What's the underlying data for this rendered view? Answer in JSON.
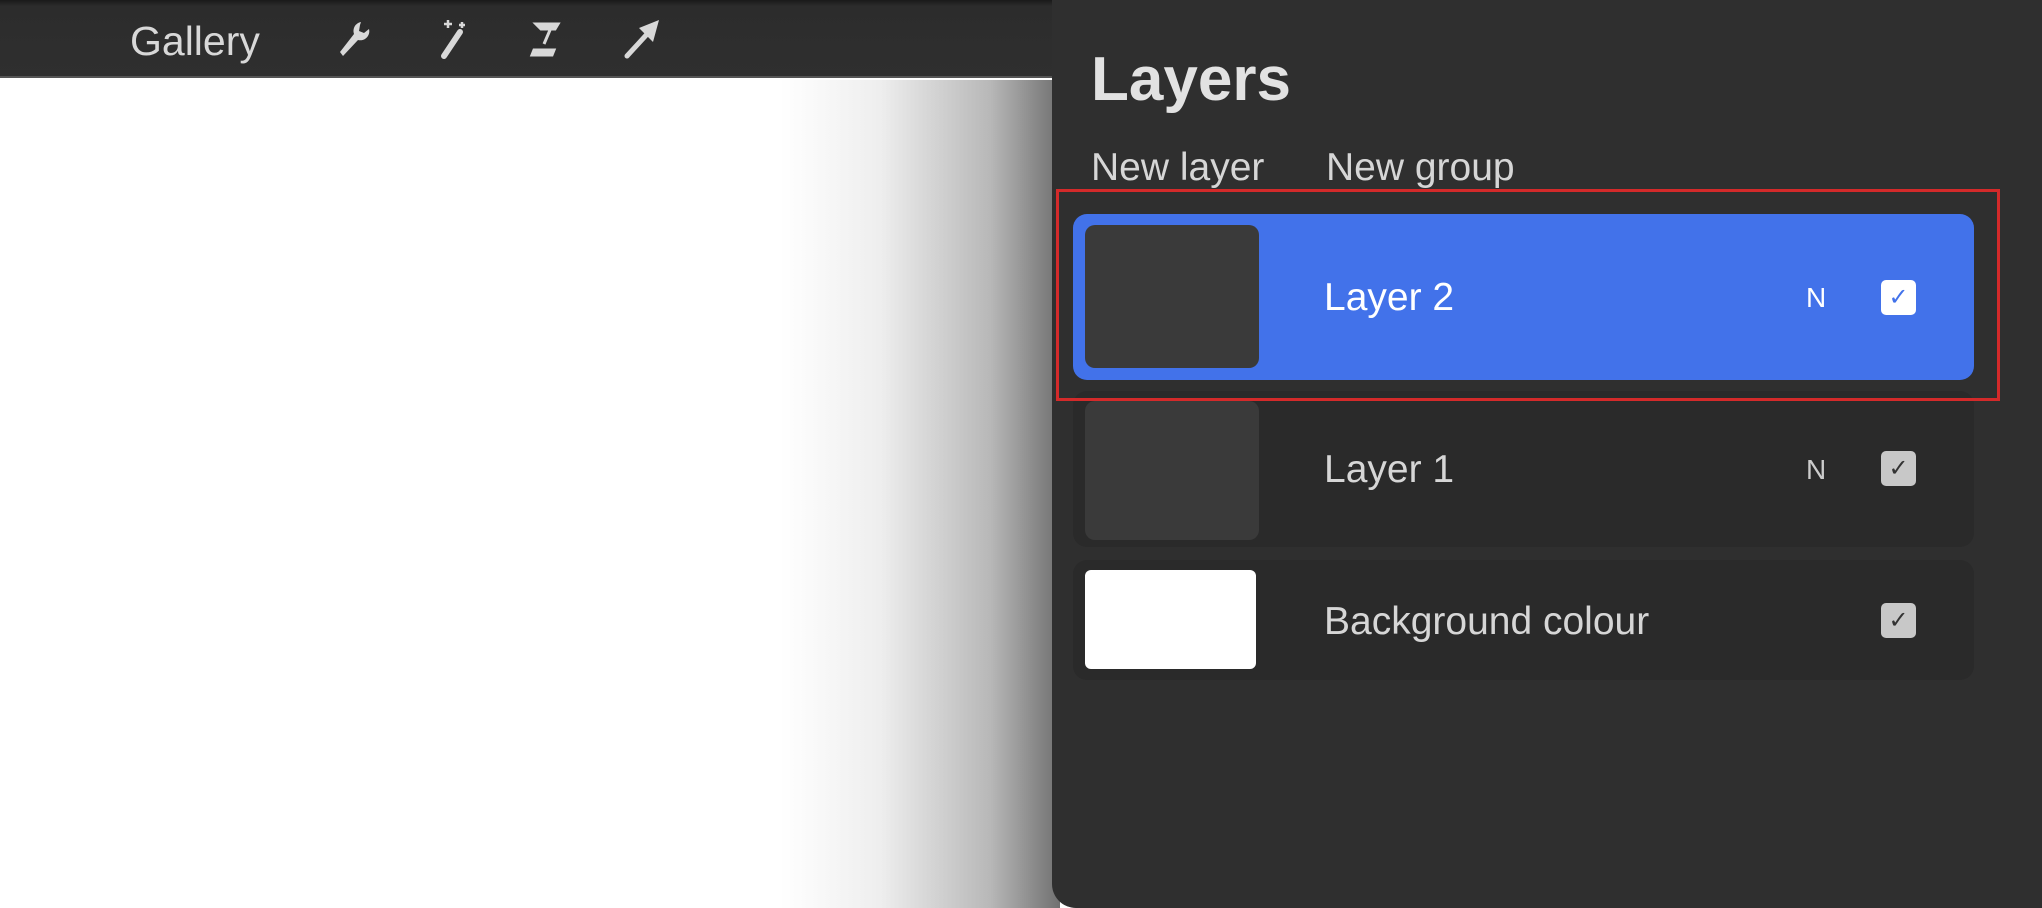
{
  "toolbar": {
    "gallery_label": "Gallery",
    "tools": [
      "wrench-icon",
      "magic-wand-icon",
      "selection-icon",
      "transform-arrow-icon"
    ]
  },
  "layers_panel": {
    "title": "Layers",
    "new_layer_label": "New layer",
    "new_group_label": "New group",
    "layers": [
      {
        "name": "Layer 2",
        "blend_mode": "N",
        "visible": true,
        "selected": true
      },
      {
        "name": "Layer 1",
        "blend_mode": "N",
        "visible": true,
        "selected": false
      },
      {
        "name": "Background colour",
        "visible": true,
        "selected": false
      }
    ]
  },
  "colors": {
    "accent": "#4272ea",
    "highlight_box": "#d42a2a",
    "panel": "#2f2f2f"
  }
}
